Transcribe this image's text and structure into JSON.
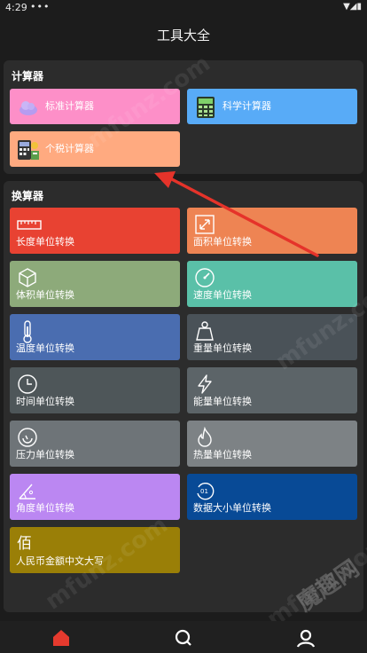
{
  "status": {
    "time": "4:29",
    "dots": "•••",
    "icons": "▼◢▮"
  },
  "app": {
    "title": "工具大全"
  },
  "calc": {
    "title": "计算器",
    "items": [
      {
        "label": "标准计算器",
        "color": "#fd8fc8",
        "icon": "cloud-icon"
      },
      {
        "label": "科学计算器",
        "color": "#58abf7",
        "icon": "calculator-icon"
      },
      {
        "label": "个税计算器",
        "color": "#ffaa80",
        "icon": "tax-calculator-icon"
      }
    ]
  },
  "convert": {
    "title": "换算器",
    "items": [
      {
        "label": "长度单位转换",
        "color": "#e84232",
        "icon": "ruler-icon"
      },
      {
        "label": "面积单位转换",
        "color": "#ee8453",
        "icon": "expand-icon"
      },
      {
        "label": "体积单位转换",
        "color": "#8daa7a",
        "icon": "cube-icon"
      },
      {
        "label": "速度单位转换",
        "color": "#5ac0a8",
        "icon": "speedometer-icon"
      },
      {
        "label": "温度单位转换",
        "color": "#4a6db0",
        "icon": "thermometer-icon"
      },
      {
        "label": "重量单位转换",
        "color": "#4a5258",
        "icon": "weight-icon"
      },
      {
        "label": "时间单位转换",
        "color": "#4e5659",
        "icon": "clock-icon"
      },
      {
        "label": "能量单位转换",
        "color": "#5c6468",
        "icon": "lightning-icon"
      },
      {
        "label": "压力单位转换",
        "color": "#6e7478",
        "icon": "gauge-icon"
      },
      {
        "label": "热量单位转换",
        "color": "#7d8285",
        "icon": "flame-icon"
      },
      {
        "label": "角度单位转换",
        "color": "#bb87f2",
        "icon": "angle-icon"
      },
      {
        "label": "数据大小单位转换",
        "color": "#084a96",
        "icon": "data-icon"
      },
      {
        "label": "人民币金额中文大写",
        "color": "#9a7f07",
        "icon": "bai-character-icon",
        "glyph": "佰"
      }
    ]
  },
  "watermarks": [
    "mfunz.com",
    "mfunz.com",
    "mfunz.com",
    "mfunz.com",
    "魔趣网"
  ],
  "colors": {
    "arrow": "#e5332a",
    "nav_active": "#e53a2e",
    "nav_inactive": "#ffffff"
  },
  "nav": [
    {
      "name": "nav-home",
      "icon": "home-icon",
      "active": true
    },
    {
      "name": "nav-search",
      "icon": "search-icon",
      "active": false
    },
    {
      "name": "nav-profile",
      "icon": "profile-icon",
      "active": false
    }
  ]
}
